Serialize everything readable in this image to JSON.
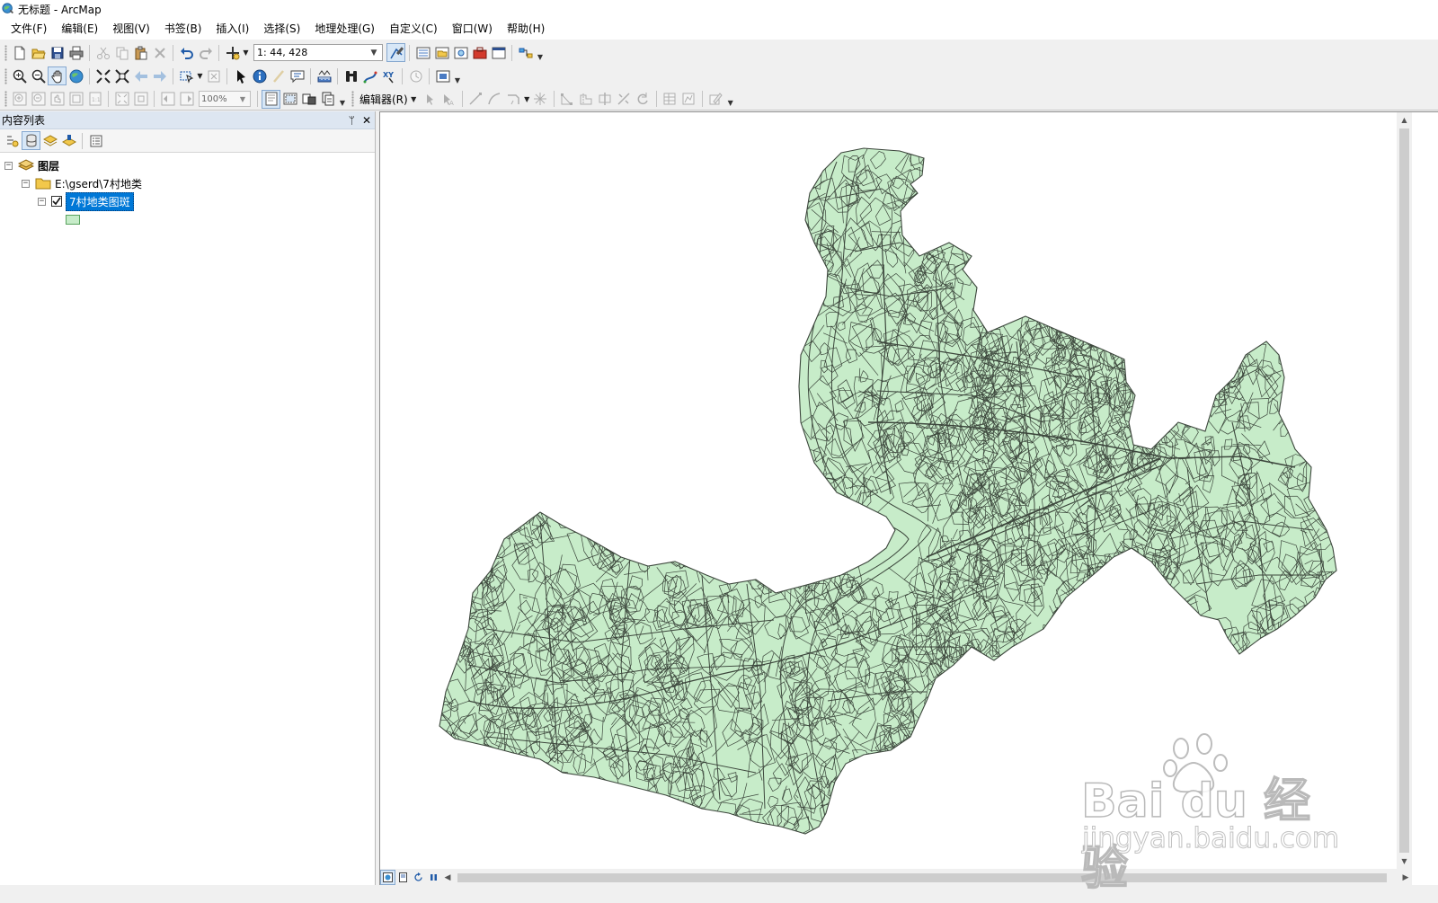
{
  "window": {
    "title": "无标题 - ArcMap"
  },
  "menu": [
    "文件(F)",
    "编辑(E)",
    "视图(V)",
    "书签(B)",
    "插入(I)",
    "选择(S)",
    "地理处理(G)",
    "自定义(C)",
    "窗口(W)",
    "帮助(H)"
  ],
  "toolbar": {
    "scale": "1: 44, 428",
    "zoom_percent": "100%",
    "editor_label": "编辑器(R)"
  },
  "toc": {
    "title": "内容列表",
    "pin_glyph": "ᛘ",
    "close_glyph": "✕",
    "layers_root": "图层",
    "folder": "E:\\gserd\\7村地类",
    "layer": "7村地类图斑",
    "layer_checked": true
  },
  "map": {
    "fill_color": "#c7ecc9",
    "stroke_color": "#3c463c"
  },
  "watermark": {
    "brand": "Bai du 经验",
    "url": "jingyan.baidu.com"
  },
  "icons": [
    "arcmap-app-icon",
    "new-document-icon",
    "open-icon",
    "save-icon",
    "print-icon",
    "cut-icon",
    "copy-icon",
    "paste-icon",
    "delete-icon",
    "undo-icon",
    "redo-icon",
    "add-data-icon",
    "editor-toolbar-icon",
    "table-of-contents-icon",
    "catalog-icon",
    "search-window-icon",
    "arctoolbox-icon",
    "python-window-icon",
    "model-builder-icon",
    "zoom-in-icon",
    "zoom-out-icon",
    "pan-icon",
    "full-extent-icon",
    "fixed-zoom-in-icon",
    "fixed-zoom-out-icon",
    "go-back-icon",
    "go-forward-icon",
    "select-features-icon",
    "clear-selection-icon",
    "select-elements-icon",
    "identify-icon",
    "hyperlink-icon",
    "html-popup-icon",
    "measure-icon",
    "find-icon",
    "find-route-icon",
    "go-to-xy-icon",
    "time-slider-icon",
    "create-viewer-window-icon"
  ]
}
